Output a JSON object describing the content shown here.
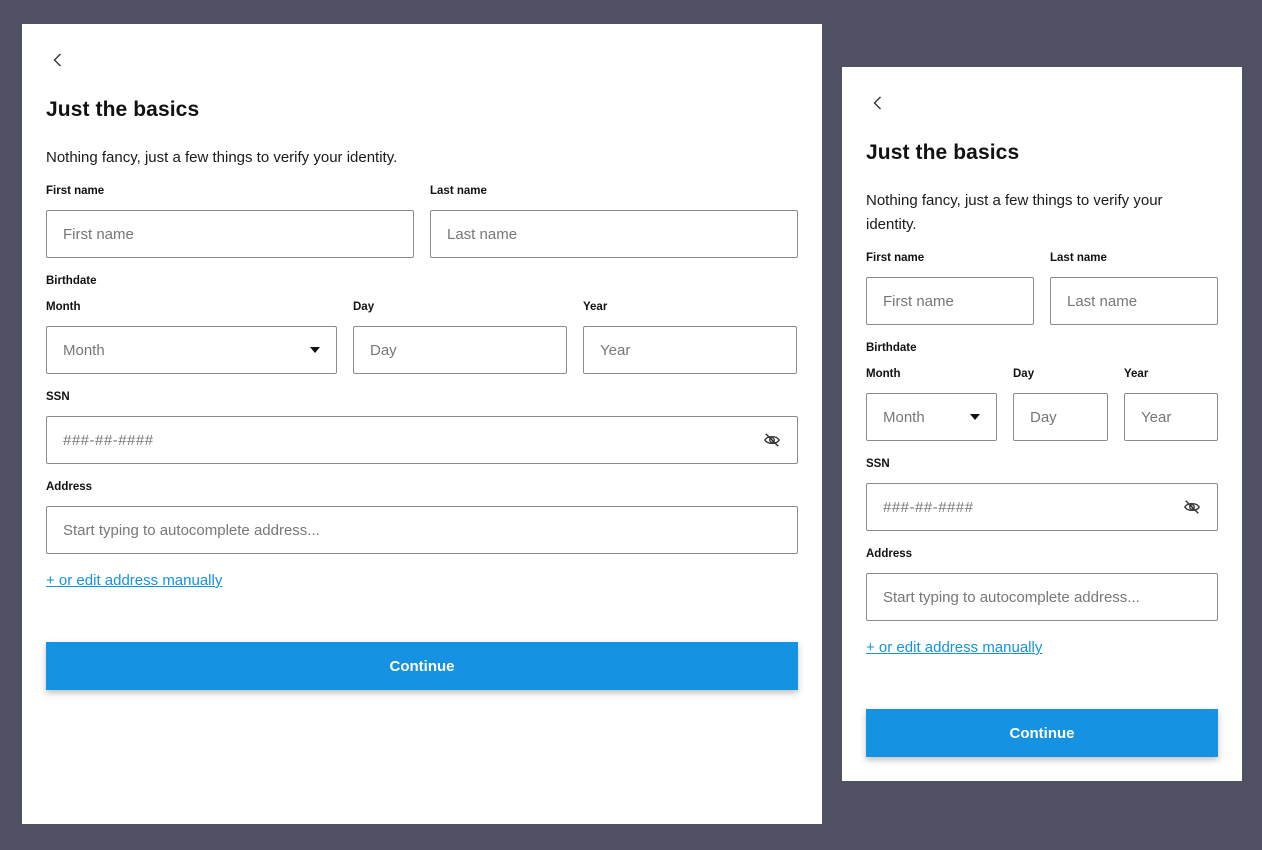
{
  "form": {
    "title": "Just the basics",
    "subtitle": "Nothing fancy, just a few things to verify your identity.",
    "first_name": {
      "label": "First name",
      "placeholder": "First name"
    },
    "last_name": {
      "label": "Last name",
      "placeholder": "Last name"
    },
    "birthdate_label": "Birthdate",
    "month": {
      "label": "Month",
      "placeholder": "Month"
    },
    "day": {
      "label": "Day",
      "placeholder": "Day"
    },
    "year": {
      "label": "Year",
      "placeholder": "Year"
    },
    "ssn": {
      "label": "SSN",
      "placeholder": "###-##-####"
    },
    "address": {
      "label": "Address",
      "placeholder": "Start typing to autocomplete address..."
    },
    "manual_address_link": "+ or edit address manually",
    "continue_label": "Continue"
  },
  "colors": {
    "background": "#4f5162",
    "accent": "#1592e2",
    "panel": "#ffffff",
    "border": "#8c8c8c"
  },
  "icons": {
    "back": "chevron-left-icon",
    "dropdown": "caret-down-icon",
    "visibility": "eye-off-icon"
  }
}
